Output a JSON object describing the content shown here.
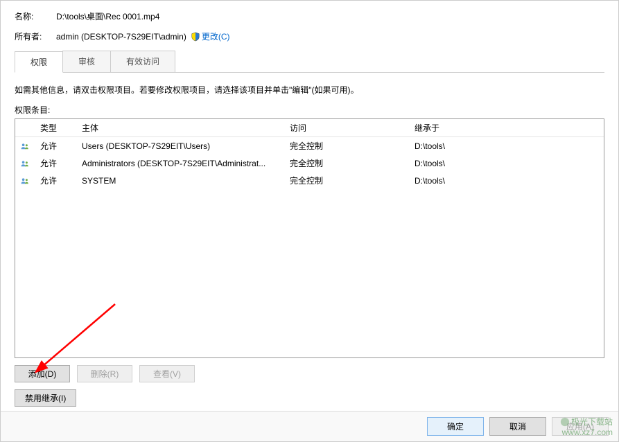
{
  "labels": {
    "name": "名称:",
    "owner": "所有者:"
  },
  "values": {
    "name": "D:\\tools\\桌面\\Rec 0001.mp4",
    "owner": "admin (DESKTOP-7S29EIT\\admin)",
    "change_link": "更改(C)"
  },
  "tabs": {
    "permissions": "权限",
    "audit": "审核",
    "effective": "有效访问"
  },
  "description": "如需其他信息，请双击权限项目。若要修改权限项目，请选择该项目并单击\"编辑\"(如果可用)。",
  "entries_label": "权限条目:",
  "columns": {
    "type": "类型",
    "principal": "主体",
    "access": "访问",
    "inherit": "继承于"
  },
  "rows": [
    {
      "type": "允许",
      "principal": "Users (DESKTOP-7S29EIT\\Users)",
      "access": "完全控制",
      "inherit": "D:\\tools\\"
    },
    {
      "type": "允许",
      "principal": "Administrators (DESKTOP-7S29EIT\\Administrat...",
      "access": "完全控制",
      "inherit": "D:\\tools\\"
    },
    {
      "type": "允许",
      "principal": "SYSTEM",
      "access": "完全控制",
      "inherit": "D:\\tools\\"
    }
  ],
  "buttons": {
    "add": "添加(D)",
    "remove": "删除(R)",
    "view": "查看(V)",
    "disable_inherit": "禁用继承(I)",
    "ok": "确定",
    "cancel": "取消",
    "apply": "应用(A)"
  },
  "watermark": {
    "line1": "极光下载站",
    "line2": "www.xz7.com"
  }
}
